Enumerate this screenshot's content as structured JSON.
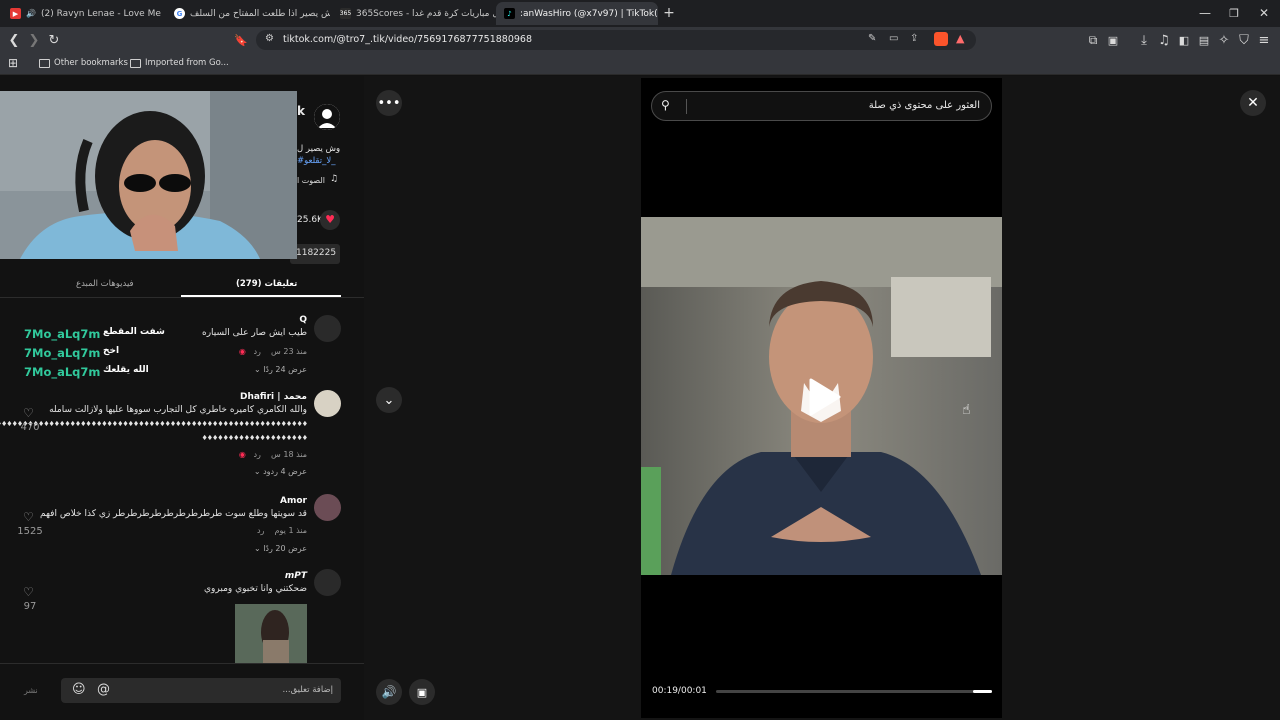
{
  "browser": {
    "tabs": [
      {
        "label": "(2) Ravyn Lenae - Love Me Not (",
        "favicon_color": "#e53935",
        "active": false
      },
      {
        "label": "وش يصير اذا طلعت المفتاح من السلف",
        "favicon_color": "#ffffff",
        "active": false
      },
      {
        "label": "جدول مباريات كرة قدم غدا - 365Scores",
        "favicon_color": "#2b2b2b",
        "active": false
      },
      {
        "label": ":anWasHiro (@x7v97) | TikTok(8)",
        "favicon_color": "#000000",
        "active": true
      }
    ],
    "url": "tiktok.com/@tro7_.tik/video/7569176877751880968",
    "bookmarks": [
      "Other bookmarks",
      "Imported from Go..."
    ]
  },
  "left_panel": {
    "author_partial": "k",
    "desc_partial": "وش يصير ل",
    "hashtag_partial": "#لا_تقلعو_",
    "sound_partial": "الصوت ا",
    "likes_partial": "25.6K",
    "link_partial": "1182225",
    "tabs": {
      "comments": "تعليقات (279)",
      "creator_videos": "فيديوهات المبدع"
    },
    "comments": [
      {
        "name": "Q",
        "text": "طيب ايش صار على السياره",
        "time": "منذ 23 س",
        "reply": "رد",
        "replies": "عرض 24 ردًا",
        "likes": ""
      },
      {
        "name": "محمد | Dhafiri",
        "text": "والله الكامري كاميره خاطري كل التجارب سووها عليها ولازالت سامله",
        "text2": "♦♦♦♦♦♦♦♦♦♦♦♦♦♦♦♦♦♦♦♦♦♦♦♦♦♦♦♦♦♦♦♦♦♦♦♦♦♦♦♦♦♦♦♦♦♦♦♦♦♦♦♦♦♦♦♦♦♦♦♦♦♦♦♦",
        "text3": "♦♦♦♦♦♦♦♦♦♦♦♦♦♦♦♦♦♦♦♦",
        "time": "منذ 18 س",
        "reply": "رد",
        "replies": "عرض 4 ردود",
        "likes": "470"
      },
      {
        "name": "Amor",
        "text": "قد سويتها وطلع سوت طرطرطرطرطرطرطرطرطر زي كذا خلاص افهم",
        "time": "منذ 1 يوم",
        "reply": "رد",
        "replies": "عرض 20 ردًا",
        "likes": "1525"
      },
      {
        "name": "mPT",
        "text": "ضحكتني وانا تخبوي ومبروي",
        "likes": "97"
      }
    ],
    "chat_overlay": [
      {
        "user": "7Mo_aLq7m",
        "msg": "شفت المقطع"
      },
      {
        "user": "7Mo_aLq7m",
        "msg": "اخخ"
      },
      {
        "user": "7Mo_aLq7m",
        "msg": "الله يقلعك"
      }
    ],
    "comment_input_placeholder": "إضافة تعليق...",
    "post_label": "نشر"
  },
  "video": {
    "search_placeholder": "العثور على محتوى ذي صلة",
    "timecode": "00:19/00:01",
    "progress_fraction": 0.07
  },
  "colors": {
    "accent_green": "#31c99c",
    "like_pink": "#fe2c55"
  }
}
